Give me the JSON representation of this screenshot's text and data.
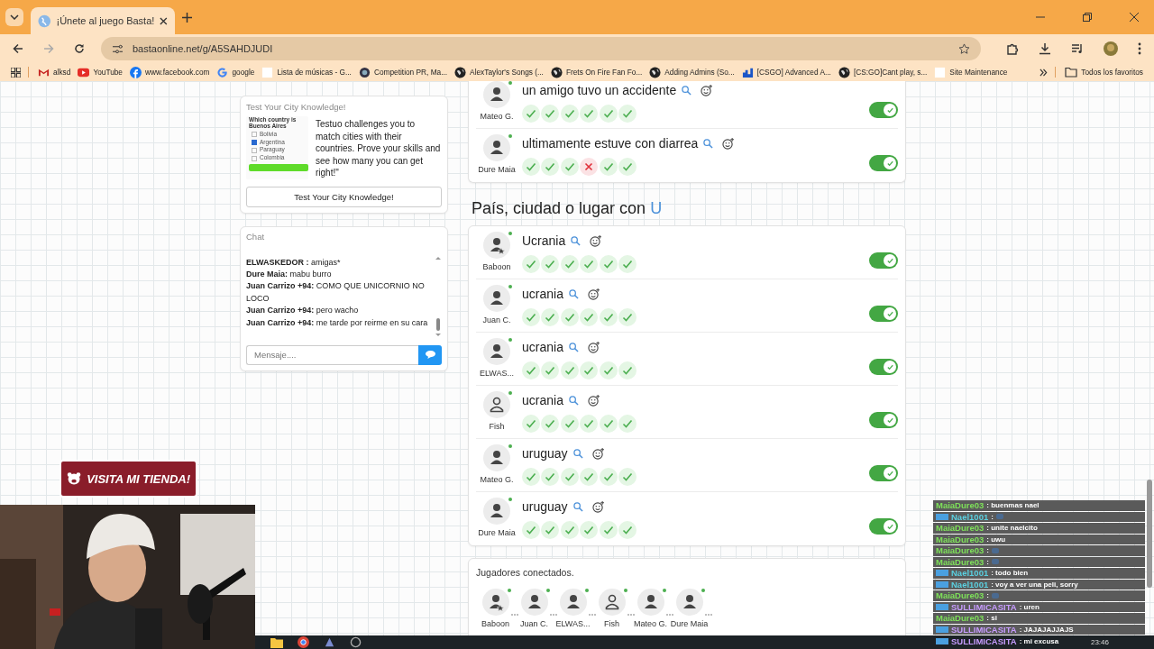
{
  "browser": {
    "tab": {
      "title": "¡Únete al juego Basta!"
    },
    "url": "bastaonline.net/g/A5SAHDJUDI",
    "bookmarks": [
      {
        "label": "alksd",
        "kind": "mail"
      },
      {
        "label": "YouTube",
        "kind": "video"
      },
      {
        "label": "www.facebook.com",
        "kind": "social"
      },
      {
        "label": "google",
        "kind": "search"
      },
      {
        "label": "Lista de músicas - G...",
        "kind": "page"
      },
      {
        "label": "Competition PR, Ma...",
        "kind": "badge"
      },
      {
        "label": "AlexTaylor's Songs (...",
        "kind": "globe"
      },
      {
        "label": "Frets On Fire Fan Fo...",
        "kind": "globe"
      },
      {
        "label": "Adding Admins (So...",
        "kind": "globe"
      },
      {
        "label": "[CSGO] Advanced A...",
        "kind": "chart"
      },
      {
        "label": "[CS:GO]Cant play, s...",
        "kind": "globe"
      },
      {
        "label": "Site Maintenance",
        "kind": "page"
      }
    ],
    "all_bookmarks": "Todos los favoritos"
  },
  "ad": {
    "title": "Test Your City Knowledge!",
    "quiz": {
      "question": "Which country is Buenos Aires",
      "options": [
        {
          "label": "Bolivia",
          "checked": false
        },
        {
          "label": "Argentina",
          "checked": true
        },
        {
          "label": "Paraguay",
          "checked": false
        },
        {
          "label": "Colombia",
          "checked": false
        }
      ]
    },
    "text": "Testuo challenges you to match cities with their countries. Prove your skills and see how many you can get right!\"",
    "button": "Test Your City Knowledge!"
  },
  "chat": {
    "title": "Chat",
    "messages": [
      "**ELWASKEDOR :** amigas*",
      "**Dure Maia:** mabu burro",
      "**Juan Carrizo +94:** COMO QUE UNICORNIO NO LOCO",
      "**Juan Carrizo +94:** pero wacho",
      "**Juan Carrizo +94:** me tarde por reirme en su cara"
    ],
    "placeholder": "Mensaje...."
  },
  "sections": [
    {
      "answers": [
        {
          "player": "Mateo G.",
          "kind": "regular",
          "word": "un amigo tuvo un accidente",
          "votes": [
            true,
            true,
            true,
            true,
            true,
            true
          ],
          "valid": true
        },
        {
          "player": "Dure Maia",
          "kind": "regular",
          "word": "ultimamente estuve con diarrea",
          "votes": [
            true,
            true,
            true,
            false,
            true,
            true
          ],
          "valid": true
        }
      ]
    },
    {
      "heading": {
        "text": "País, ciudad o lugar con ",
        "letter": "U"
      },
      "answers": [
        {
          "player": "Baboon",
          "kind": "host",
          "word": "Ucrania",
          "votes": [
            true,
            true,
            true,
            true,
            true,
            true
          ],
          "valid": true
        },
        {
          "player": "Juan C.",
          "kind": "regular",
          "word": "ucrania",
          "votes": [
            true,
            true,
            true,
            true,
            true,
            true
          ],
          "valid": true
        },
        {
          "player": "ELWAS...",
          "kind": "regular",
          "word": "ucrania",
          "votes": [
            true,
            true,
            true,
            true,
            true,
            true
          ],
          "valid": true
        },
        {
          "player": "Fish",
          "kind": "outline",
          "word": "ucrania",
          "votes": [
            true,
            true,
            true,
            true,
            true,
            true
          ],
          "valid": true
        },
        {
          "player": "Mateo G.",
          "kind": "regular",
          "word": "uruguay",
          "votes": [
            true,
            true,
            true,
            true,
            true,
            true
          ],
          "valid": true
        },
        {
          "player": "Dure Maia",
          "kind": "regular",
          "word": "uruguay",
          "votes": [
            true,
            true,
            true,
            true,
            true,
            true
          ],
          "valid": true
        }
      ]
    }
  ],
  "connected": {
    "title": "Jugadores conectados.",
    "players": [
      {
        "name": "Baboon",
        "kind": "host"
      },
      {
        "name": "Juan C.",
        "kind": "regular"
      },
      {
        "name": "ELWAS...",
        "kind": "regular"
      },
      {
        "name": "Fish",
        "kind": "outline"
      },
      {
        "name": "Mateo G.",
        "kind": "regular"
      },
      {
        "name": "Dure Maia",
        "kind": "regular"
      }
    ]
  },
  "stream": {
    "banner": "VISITA MI TIENDA!",
    "chat": [
      {
        "user": "MaiaDure03",
        "badge": false,
        "color": "#7ee05a",
        "kind": "text",
        "text": ": buenmas nael"
      },
      {
        "user": "Nael1001",
        "badge": true,
        "color": "#5ad0e0",
        "kind": "emote",
        "text": ":"
      },
      {
        "user": "MaiaDure03",
        "badge": false,
        "color": "#7ee05a",
        "kind": "text",
        "text": ": unite naelcito"
      },
      {
        "user": "MaiaDure03",
        "badge": false,
        "color": "#7ee05a",
        "kind": "text",
        "text": ": uwu"
      },
      {
        "user": "MaiaDure03",
        "badge": false,
        "color": "#7ee05a",
        "kind": "emote",
        "text": ":"
      },
      {
        "user": "MaiaDure03",
        "badge": false,
        "color": "#7ee05a",
        "kind": "emote",
        "text": ":"
      },
      {
        "user": "Nael1001",
        "badge": true,
        "color": "#5ad0e0",
        "kind": "text",
        "text": ": todo bien"
      },
      {
        "user": "Nael1001",
        "badge": true,
        "color": "#5ad0e0",
        "kind": "text",
        "text": ": voy a ver una peli, sorry"
      },
      {
        "user": "MaiaDure03",
        "badge": false,
        "color": "#7ee05a",
        "kind": "emote",
        "text": ":"
      },
      {
        "user": "SULLIMICASITA",
        "badge": true,
        "color": "#c79cff",
        "kind": "text",
        "text": ": uren"
      },
      {
        "user": "MaiaDure03",
        "badge": false,
        "color": "#7ee05a",
        "kind": "text",
        "text": ": si"
      },
      {
        "user": "SULLIMICASITA",
        "badge": true,
        "color": "#c79cff",
        "kind": "text",
        "text": ": JAJAJAJJAJS"
      },
      {
        "user": "SULLIMICASITA",
        "badge": true,
        "color": "#c79cff",
        "kind": "text",
        "text": ": mi excusa"
      }
    ]
  },
  "taskbar": {
    "time": "23:46"
  }
}
